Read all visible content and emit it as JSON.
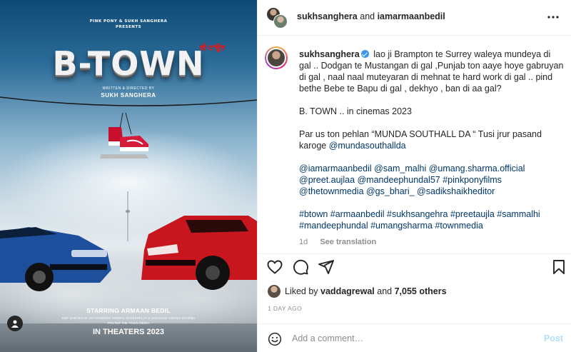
{
  "poster": {
    "presents_line1": "PINK PONY & SUKH SANGHERA",
    "presents_line2": "PRESENTS",
    "title": "B-TOWN",
    "title_punjabi": "ਬੀ-ਟਾਊਨ",
    "credit_small": "WRITTEN & DIRECTED BY",
    "credit_name": "SUKH SANGHERA",
    "starring": "STARRING ARMAAN BEDIL",
    "crew_line1": "DOP SAM MALHI   1ST MANDEEP HUNDAL   SCREENPLAY & DIALOGUE UMANG SHARMA",
    "crew_line2": "POSTER THE TOWN MEDIA",
    "theaters": "IN THEATERS 2023"
  },
  "header": {
    "user1": "sukhsanghera",
    "and": " and ",
    "user2": "iamarmaanbedil"
  },
  "caption": {
    "username": "sukhsanghera",
    "para1": "lao ji Brampton te Surrey waleya mundeya di gal .. Dodgan te Mustangan di gal ,Punjab ton aaye hoye gabruyan di gal , naal naal muteyaran di mehnat te hard work di gal .. pind bethe Bebe te Bapu di gal , dekhyo , ban di aa gal?",
    "para2": "B. TOWN .. in cinemas 2023",
    "para3_text": "Par us ton pehlan “MUNDA SOUTHALL DA “ Tusi jrur pasand karoge ",
    "para3_link": "@mundasouthallda",
    "mentions": "@iamarmaanbedil @sam_malhi @umang.sharma.official @preet.aujlaa @mandeephundal57 #pinkponyfilms @thetownmedia @gs_bhari_ @sadikshaikheditor",
    "hashtags": "#btown #armaanbedil #sukhsangehra #preetaujla #sammalhi #mandeephundal #umangsharma #townmedia",
    "age": "1d",
    "see_translation": "See translation"
  },
  "likes": {
    "prefix": "Liked by ",
    "user": "vaddagrewal",
    "and": " and ",
    "count": "7,055 others"
  },
  "timestamp": "1 DAY AGO",
  "comment": {
    "placeholder": "Add a comment…",
    "post_label": "Post"
  },
  "colors": {
    "link": "#00376b",
    "verified": "#3897f0",
    "muted": "#8e8e8e",
    "post_disabled": "#b2dffc"
  },
  "icons": [
    "more-icon",
    "heart-icon",
    "comment-icon",
    "share-icon",
    "bookmark-icon",
    "emoji-icon",
    "tagged-user-icon",
    "verified-icon"
  ]
}
